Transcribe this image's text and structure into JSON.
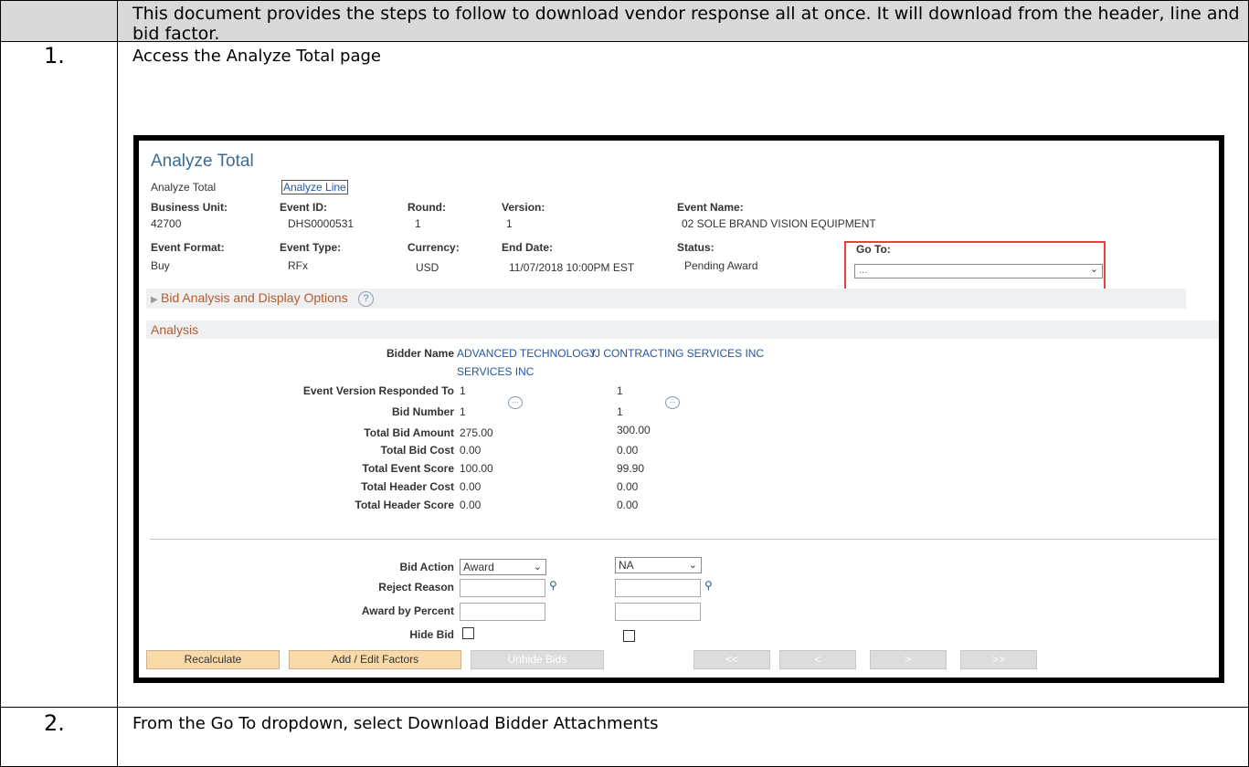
{
  "header": {
    "intro": "This document provides the steps to follow to download vendor response all at once.  It will download from the header, line and bid factor."
  },
  "steps": [
    {
      "number": "1.",
      "text": "Access the Analyze Total page"
    },
    {
      "number": "2.",
      "text": "From the Go To dropdown, select Download Bidder Attachments"
    }
  ],
  "screen": {
    "title": "Analyze Total",
    "tabs": {
      "current": "Analyze Total",
      "link": "Analyze Line"
    },
    "fields": {
      "business_unit_label": "Business Unit:",
      "business_unit": "42700",
      "event_id_label": "Event ID:",
      "event_id": "DHS0000531",
      "round_label": "Round:",
      "round": "1",
      "version_label": "Version:",
      "version": "1",
      "event_name_label": "Event Name:",
      "event_name": "02 SOLE BRAND VISION EQUIPMENT",
      "event_format_label": "Event Format:",
      "event_format": "Buy",
      "event_type_label": "Event Type:",
      "event_type": "RFx",
      "currency_label": "Currency:",
      "currency": "USD",
      "end_date_label": "End Date:",
      "end_date": "11/07/2018 10:00PM EST",
      "status_label": "Status:",
      "status": "Pending Award",
      "goto_label": "Go To:",
      "goto_value": "..."
    },
    "bid_options_label": "Bid Analysis and Display Options",
    "help_glyph": "?",
    "analysis_label": "Analysis",
    "analysis": {
      "bidder_name_label": "Bidder Name",
      "bidder1": {
        "name1": "ADVANCED TECHNOLOGY",
        "name2": "SERVICES INC"
      },
      "bidder2": {
        "name": "JJ CONTRACTING SERVICES INC"
      },
      "rows": [
        {
          "label": "Event Version Responded To",
          "v1": "1",
          "v2": "1"
        },
        {
          "label": "Bid Number",
          "v1": "1",
          "v2": "1"
        },
        {
          "label": "Total Bid Amount",
          "v1": "275.00",
          "v2": "300.00"
        },
        {
          "label": "Total Bid Cost",
          "v1": "0.00",
          "v2": "0.00"
        },
        {
          "label": "Total Event Score",
          "v1": "100.00",
          "v2": "99.90"
        },
        {
          "label": "Total Header Cost",
          "v1": "0.00",
          "v2": "0.00"
        },
        {
          "label": "Total Header Score",
          "v1": "0.00",
          "v2": "0.00"
        }
      ]
    },
    "actions": {
      "bid_action_label": "Bid Action",
      "bid_action1": "Award",
      "bid_action2": "NA",
      "reject_reason_label": "Reject Reason",
      "award_percent_label": "Award by Percent",
      "hide_bid_label": "Hide Bid"
    },
    "buttons": {
      "recalculate": "Recalculate",
      "add_edit_factors": "Add / Edit Factors",
      "unhide_bids": "Unhide Bids",
      "first": "<<",
      "prev": "<",
      "next": ">",
      "last": ">>"
    }
  }
}
